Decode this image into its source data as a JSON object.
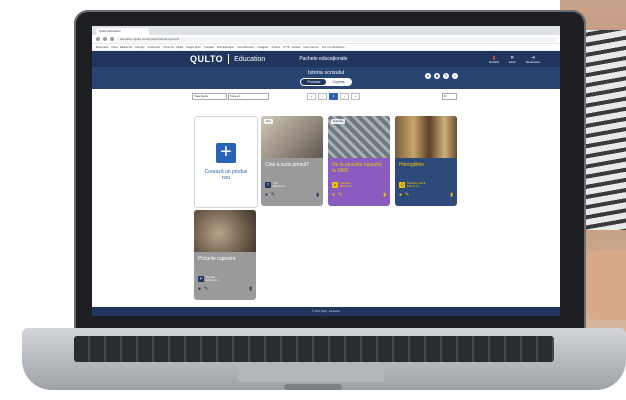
{
  "browser": {
    "tab_title": "Quilto Education",
    "url": "education.quilto.com/product/istoria-scrisului",
    "bookmarks": [
      "Bookmarks",
      "Inbox - Mailbox Ro",
      "Edit app",
      "Customizer",
      "Home Go - Digital",
      "Google Drive",
      "Translate",
      "Web Education",
      "Cloud Browsing",
      "Instagram",
      "Product",
      "PTTP - website",
      "Learn quizzes",
      "Log in to WordPress"
    ]
  },
  "app": {
    "brand": "QULTO",
    "section": "Education",
    "packages_label": "Pachete educaționale",
    "header_icons": [
      {
        "icon": "flag-icon",
        "label": "Română"
      },
      {
        "icon": "tools-icon",
        "label": "Admin"
      },
      {
        "icon": "logout-icon",
        "label": "Deconectare"
      }
    ]
  },
  "subheader": {
    "title": "Istoria scrisului",
    "tabs": [
      {
        "label": "Produse",
        "active": true
      },
      {
        "label": "Cuprins",
        "active": false
      }
    ]
  },
  "filters": {
    "select_1": "Toate tipurile",
    "select_2": "Toate ed...",
    "per_page": "10",
    "pages": [
      "«",
      "‹",
      "1",
      "›",
      "»"
    ],
    "active_page": "1"
  },
  "create_card": {
    "label": "Creează un produs nou"
  },
  "cards": [
    {
      "title": "Cine a scris primul?",
      "color": "#9a9a9a",
      "meta_icon": "T",
      "meta_line1": "Text",
      "meta_line2": "Editura 1.1",
      "tag": "Text"
    },
    {
      "title": "De la picturile rupestre la SMS",
      "color": "#8a5cc0",
      "meta_icon": "A",
      "meta_line1": "Activitate",
      "meta_line2": "Editura 1.0",
      "tag": "Activitate"
    },
    {
      "title": "Hieroglifele",
      "color": "#2d4a7a",
      "meta_icon": "Q",
      "meta_line1": "Întrebare cultură",
      "meta_line2": "Editura 1.0",
      "tag": ""
    },
    {
      "title": "Picturile rupestre",
      "color": "#9a9a9a",
      "meta_icon": "P",
      "meta_line1": "Poveste",
      "meta_line2": "Editura 1.1",
      "tag": ""
    }
  ],
  "footer": {
    "text": "© 2021 Qulto · Education"
  },
  "colors": {
    "primary": "#20365f",
    "accent": "#2a63b5",
    "yellow": "#f5c400"
  }
}
